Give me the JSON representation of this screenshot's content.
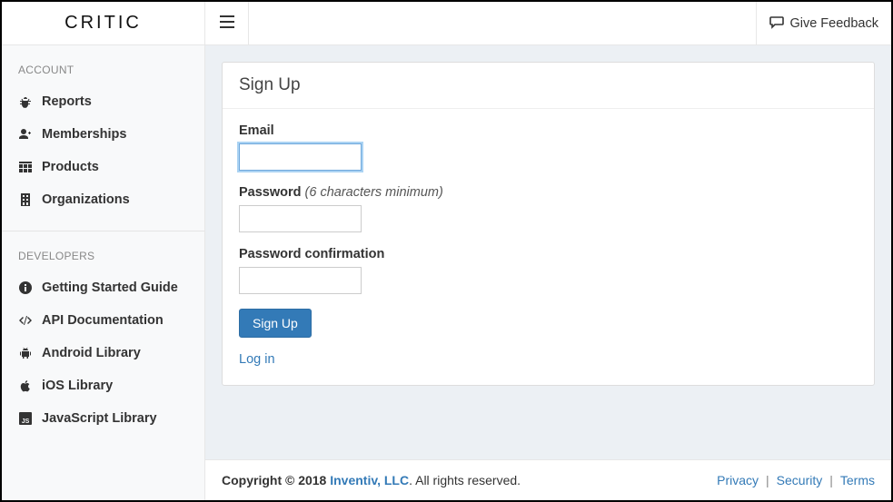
{
  "brand": "CRITIC",
  "topbar": {
    "feedback_label": "Give Feedback"
  },
  "sidebar": {
    "sections": [
      {
        "header": "ACCOUNT",
        "items": [
          {
            "icon": "bug-icon",
            "label": "Reports"
          },
          {
            "icon": "user-plus-icon",
            "label": "Memberships"
          },
          {
            "icon": "grid-icon",
            "label": "Products"
          },
          {
            "icon": "building-icon",
            "label": "Organizations"
          }
        ]
      },
      {
        "header": "DEVELOPERS",
        "items": [
          {
            "icon": "info-icon",
            "label": "Getting Started Guide"
          },
          {
            "icon": "code-icon",
            "label": "API Documentation"
          },
          {
            "icon": "android-icon",
            "label": "Android Library"
          },
          {
            "icon": "apple-icon",
            "label": "iOS Library"
          },
          {
            "icon": "js-icon",
            "label": "JavaScript Library"
          }
        ]
      }
    ]
  },
  "page": {
    "title": "Sign Up",
    "email_label": "Email",
    "password_label": "Password",
    "password_hint": "(6 characters minimum)",
    "confirm_label": "Password confirmation",
    "submit_label": "Sign Up",
    "login_link": "Log in"
  },
  "footer": {
    "copyright_prefix": "Copyright © 2018 ",
    "company": "Inventiv, LLC",
    "copyright_suffix": ". All rights reserved.",
    "links": [
      "Privacy",
      "Security",
      "Terms"
    ]
  }
}
